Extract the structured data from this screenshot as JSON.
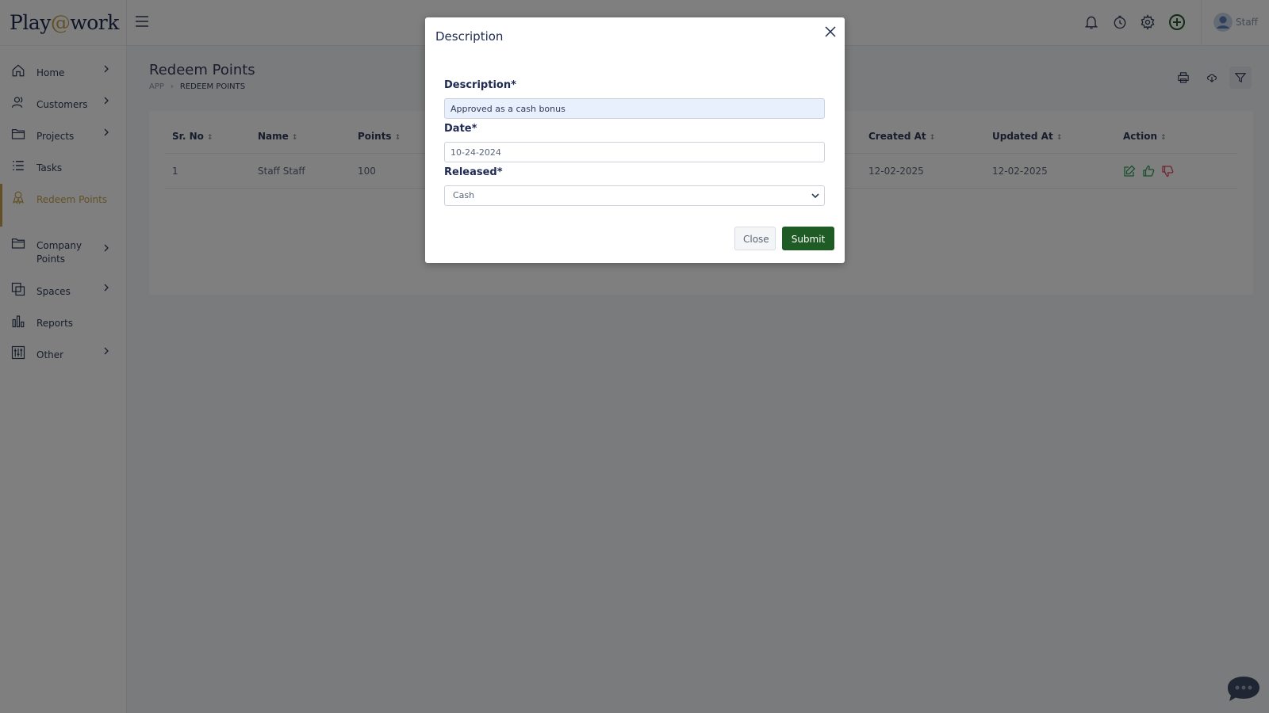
{
  "app": {
    "logo_prefix": "Play",
    "logo_at": "@",
    "logo_suffix": "work"
  },
  "sidebar": {
    "items": [
      {
        "label": "Home",
        "icon": "home-icon",
        "has_chevron": true
      },
      {
        "label": "Customers",
        "icon": "users-icon",
        "has_chevron": true
      },
      {
        "label": "Projects",
        "icon": "folder-icon",
        "has_chevron": true
      },
      {
        "label": "Tasks",
        "icon": "list-icon",
        "has_chevron": false
      },
      {
        "label": "Redeem Points",
        "icon": "redeem-icon",
        "has_chevron": false,
        "active": true
      },
      {
        "label": "Company Points",
        "icon": "folder-icon",
        "has_chevron": true
      },
      {
        "label": "Spaces",
        "icon": "spaces-icon",
        "has_chevron": true
      },
      {
        "label": "Reports",
        "icon": "bar-chart-icon",
        "has_chevron": false
      },
      {
        "label": "Other",
        "icon": "sliders-icon",
        "has_chevron": true
      }
    ]
  },
  "header": {
    "user_name": "Staff",
    "icons": [
      "bell-icon",
      "clock-icon",
      "gear-icon",
      "add-circle-icon"
    ]
  },
  "page": {
    "title": "Redeem Points",
    "breadcrumb_root": "APP",
    "breadcrumb_current": "REDEEM POINTS"
  },
  "table": {
    "columns": [
      "Sr. No",
      "Name",
      "Points",
      "Created At",
      "Updated At",
      "Action"
    ],
    "rows": [
      {
        "sr_no": "1",
        "name": "Staff Staff",
        "points": "100",
        "created_at": "12-02-2025",
        "updated_at": "12-02-2025"
      }
    ]
  },
  "modal": {
    "title": "Description",
    "description_label": "Description*",
    "description_value": "Approved as a cash bonus",
    "date_label": "Date*",
    "date_value": "10-24-2024",
    "released_label": "Released*",
    "released_value": "Cash",
    "close_label": "Close",
    "submit_label": "Submit"
  },
  "colors": {
    "accent_gold": "#c7a34a",
    "submit_green": "#1f5b24",
    "navy": "#1f2a52",
    "action_green": "#2e9e5b",
    "action_red": "#e0475a"
  }
}
